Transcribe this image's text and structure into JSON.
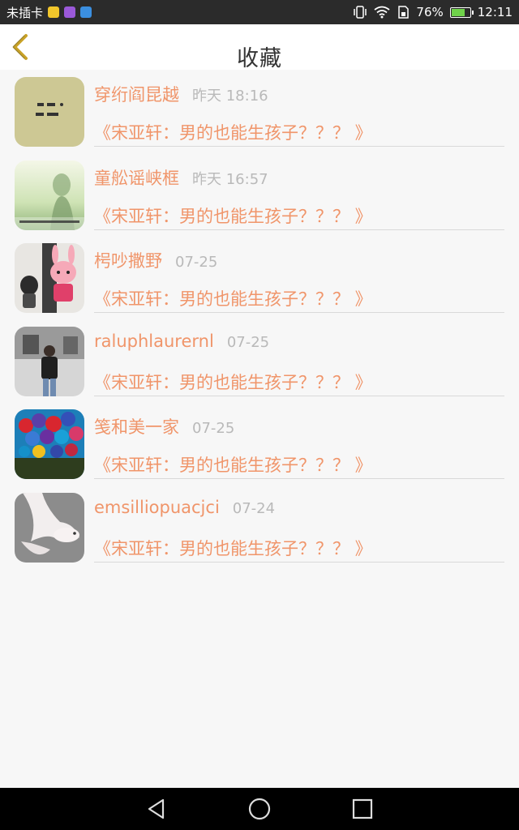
{
  "status_bar": {
    "carrier": "未插卡",
    "battery": "76%",
    "time": "12:11",
    "battery_level": 0.76,
    "colors": {
      "app1": "#f2c62b",
      "app2": "#9b59d9",
      "app3": "#3b8fe0",
      "battery": "#6fd24a"
    }
  },
  "header": {
    "title": "收藏",
    "back_icon": "chevron-left-icon",
    "accent": "#c9a227"
  },
  "colors": {
    "name": "#f0956a",
    "time": "#b9b9b9",
    "divider": "#d9d9d9",
    "background": "#f7f7f7"
  },
  "items": [
    {
      "name": "穿绗阎昆越",
      "time": "昨天 18:16",
      "message": "《宋亚轩：男的也能生孩子？？？ 》",
      "avatar_text": ""
    },
    {
      "name": "童舩谣峡框",
      "time": "昨天 16:57",
      "message": "《宋亚轩：男的也能生孩子？？？ 》",
      "avatar_text": ""
    },
    {
      "name": "枵吵撒野",
      "time": "07-25",
      "message": "《宋亚轩：男的也能生孩子？？？ 》",
      "avatar_text": ""
    },
    {
      "name": "raluphlaurernl",
      "time": "07-25",
      "message": "《宋亚轩：男的也能生孩子？？？ 》",
      "avatar_text": ""
    },
    {
      "name": "笺和美一家",
      "time": "07-25",
      "message": "《宋亚轩：男的也能生孩子？？？ 》",
      "avatar_text": ""
    },
    {
      "name": "emsilliopuacjci",
      "time": "07-24",
      "message": "《宋亚轩：男的也能生孩子？？？ 》",
      "avatar_text": ""
    }
  ],
  "nav": {
    "back": "triangle-back-icon",
    "home": "circle-home-icon",
    "recents": "square-recents-icon"
  }
}
